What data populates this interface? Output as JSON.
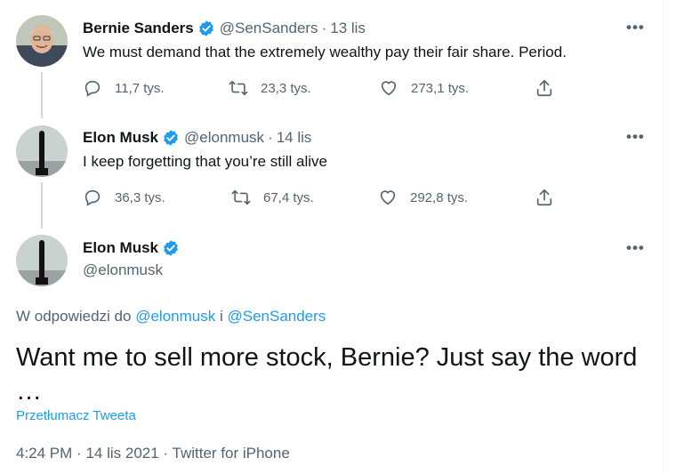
{
  "tweet1": {
    "name": "Bernie Sanders",
    "handle": "@SenSanders",
    "dot": "·",
    "date": "13 lis",
    "text": "We must demand that the extremely wealthy pay their fair share. Period.",
    "replies": "11,7 tys.",
    "retweets": "23,3 tys.",
    "likes": "273,1 tys.",
    "more": "•••"
  },
  "tweet2": {
    "name": "Elon Musk",
    "handle": "@elonmusk",
    "dot": "·",
    "date": "14 lis",
    "text": "I keep forgetting that you’re still alive",
    "replies": "36,3 tys.",
    "retweets": "67,4 tys.",
    "likes": "292,8 tys.",
    "more": "•••"
  },
  "main_tweet": {
    "name": "Elon Musk",
    "handle": "@elonmusk",
    "more": "•••",
    "reply_prefix": "W odpowiedzi do",
    "reply_user1": "@elonmusk",
    "reply_and": "i",
    "reply_user2": "@SenSanders",
    "text_line1": "Want me to sell more stock, Bernie? Just say the word",
    "text_line2": "…",
    "translate": "Przetłumacz Tweeta",
    "time": "4:24 PM",
    "dot": "·",
    "date": "14 lis 2021",
    "source": "Twitter for iPhone"
  },
  "icons": [
    "reply-icon",
    "retweet-icon",
    "like-icon",
    "share-icon",
    "verified-badge-icon"
  ],
  "colors": {
    "accent": "#1d9bf0",
    "muted": "#536471",
    "text": "#0f1419"
  }
}
